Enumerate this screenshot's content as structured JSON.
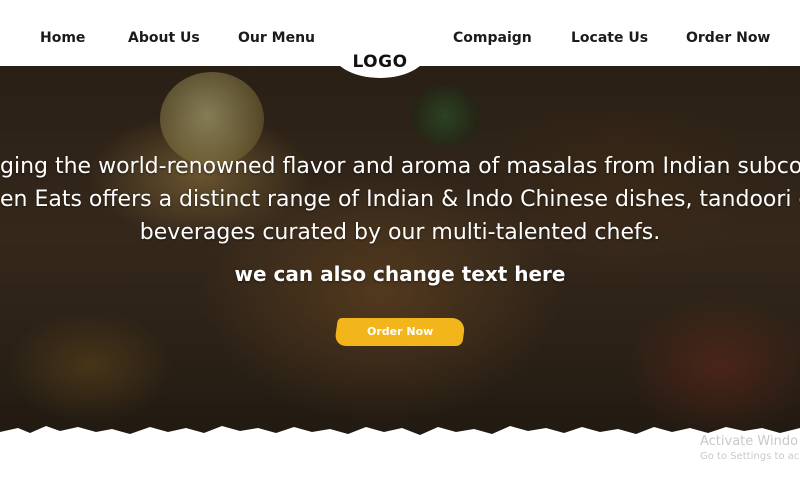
{
  "nav": {
    "items": [
      {
        "label": "Home"
      },
      {
        "label": "About Us"
      },
      {
        "label": "Our Menu"
      },
      {
        "label": "Compaign"
      },
      {
        "label": "Locate Us"
      },
      {
        "label": "Order Now"
      }
    ],
    "logo": "LOGO"
  },
  "hero": {
    "lines": [
      "ging the world-renowned flavor and aroma of masalas from Indian subco",
      "en Eats offers a distinct range of Indian & Indo Chinese dishes, tandoori g",
      "beverages curated by our multi-talented chefs."
    ],
    "subtext": "we can also change text here",
    "cta_label": "Order Now",
    "cta_color": "#f2b51c"
  },
  "watermark": {
    "line1": "Activate Windo",
    "line2": "Go to Settings to ac"
  }
}
